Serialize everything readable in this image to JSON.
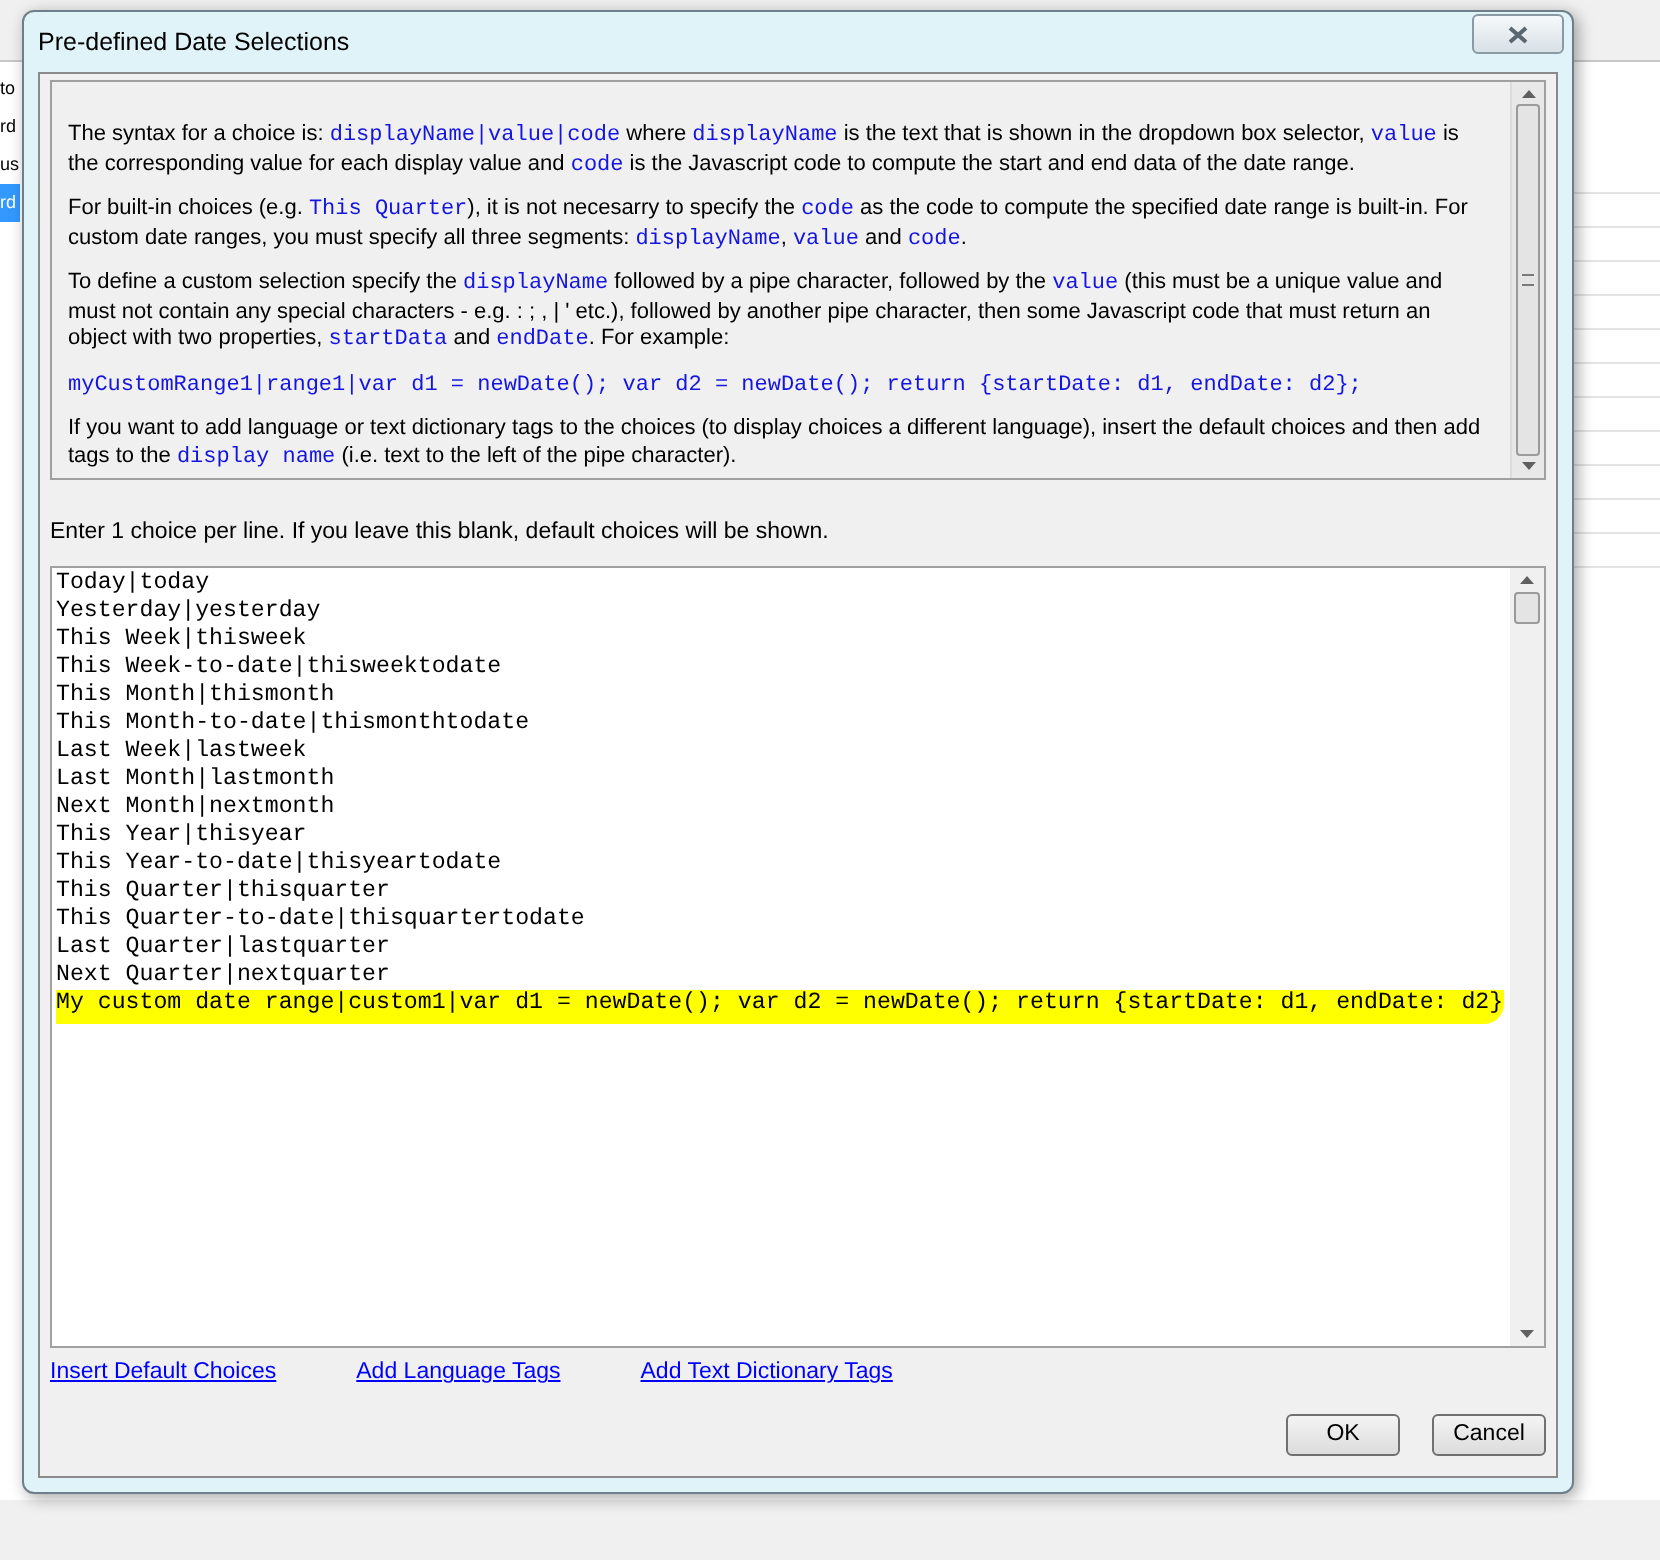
{
  "background_list": [
    {
      "text": "to",
      "selected": false
    },
    {
      "text": "rd",
      "selected": false
    },
    {
      "text": "us",
      "selected": false
    },
    {
      "text": "rd",
      "selected": true
    }
  ],
  "window": {
    "title": "Pre-defined Date Selections"
  },
  "help_text": [
    [
      {
        "kind": "plain",
        "text": "The syntax for a choice is: "
      },
      {
        "kind": "code",
        "text": "displayName|value|code"
      },
      {
        "kind": "plain",
        "text": " where "
      },
      {
        "kind": "code",
        "text": "displayName"
      },
      {
        "kind": "plain",
        "text": " is the text that is shown in the dropdown box selector, "
      },
      {
        "kind": "code",
        "text": "value"
      },
      {
        "kind": "plain",
        "text": " is the corresponding value for each display value and "
      },
      {
        "kind": "code",
        "text": "code"
      },
      {
        "kind": "plain",
        "text": " is the Javascript code to compute the start and end data of the date range."
      }
    ],
    [
      {
        "kind": "plain",
        "text": "For built-in choices (e.g. "
      },
      {
        "kind": "code",
        "text": "This Quarter"
      },
      {
        "kind": "plain",
        "text": "), it is not necesarry to specify the "
      },
      {
        "kind": "code",
        "text": "code"
      },
      {
        "kind": "plain",
        "text": " as the code to compute the specified date range is built-in. For custom date ranges, you must specify all three segments: "
      },
      {
        "kind": "code",
        "text": "displayName"
      },
      {
        "kind": "plain",
        "text": ", "
      },
      {
        "kind": "code",
        "text": "value"
      },
      {
        "kind": "plain",
        "text": " and "
      },
      {
        "kind": "code",
        "text": "code"
      },
      {
        "kind": "plain",
        "text": "."
      }
    ],
    [
      {
        "kind": "plain",
        "text": "To define a custom selection specify the "
      },
      {
        "kind": "code",
        "text": "displayName"
      },
      {
        "kind": "plain",
        "text": " followed by a pipe character, followed by the "
      },
      {
        "kind": "code",
        "text": "value"
      },
      {
        "kind": "plain",
        "text": " (this must be a unique value and must not contain any special characters - e.g. : ; , | ' etc.), followed by another pipe character, then some Javascript code that must return an object with two properties, "
      },
      {
        "kind": "code",
        "text": "startData"
      },
      {
        "kind": "plain",
        "text": " and "
      },
      {
        "kind": "code",
        "text": "endDate"
      },
      {
        "kind": "plain",
        "text": ". For example:"
      }
    ],
    [
      {
        "kind": "code",
        "text": "myCustomRange1|range1|var d1 = newDate(); var d2 = newDate(); return {startDate: d1, endDate: d2};"
      }
    ],
    [
      {
        "kind": "plain",
        "text": "If you want to add language or text dictionary tags to the choices (to display choices a different language), insert the default choices and then add tags to the "
      },
      {
        "kind": "code",
        "text": "display name"
      },
      {
        "kind": "plain",
        "text": " (i.e. text to the left of the pipe character)."
      }
    ]
  ],
  "instruction": "Enter 1 choice per line. If you leave this blank, default choices will be shown.",
  "choices": [
    {
      "text": "Today|today",
      "highlighted": false
    },
    {
      "text": "Yesterday|yesterday",
      "highlighted": false
    },
    {
      "text": "This Week|thisweek",
      "highlighted": false
    },
    {
      "text": "This Week-to-date|thisweektodate",
      "highlighted": false
    },
    {
      "text": "This Month|thismonth",
      "highlighted": false
    },
    {
      "text": "This Month-to-date|thismonthtodate",
      "highlighted": false
    },
    {
      "text": "Last Week|lastweek",
      "highlighted": false
    },
    {
      "text": "Last Month|lastmonth",
      "highlighted": false
    },
    {
      "text": "Next Month|nextmonth",
      "highlighted": false
    },
    {
      "text": "This Year|thisyear",
      "highlighted": false
    },
    {
      "text": "This Year-to-date|thisyeartodate",
      "highlighted": false
    },
    {
      "text": "This Quarter|thisquarter",
      "highlighted": false
    },
    {
      "text": "This Quarter-to-date|thisquartertodate",
      "highlighted": false
    },
    {
      "text": "Last Quarter|lastquarter",
      "highlighted": false
    },
    {
      "text": "Next Quarter|nextquarter",
      "highlighted": false
    },
    {
      "text": "My custom date range|custom1|var d1 = newDate(); var d2 = newDate(); return {startDate: d1, endDate: d2}",
      "highlighted": true
    }
  ],
  "links": [
    "Insert Default Choices",
    "Add Language Tags",
    "Add Text Dictionary Tags"
  ],
  "buttons": [
    "OK",
    "Cancel"
  ]
}
